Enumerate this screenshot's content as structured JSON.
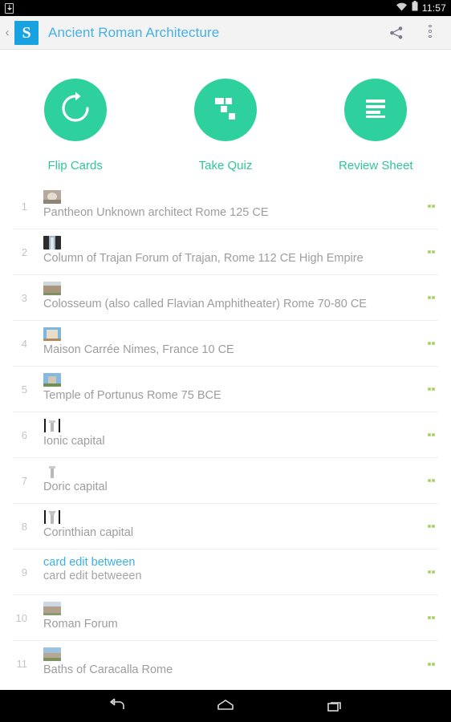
{
  "status_bar": {
    "download_icon": "download-icon",
    "wifi_icon": "wifi-icon",
    "battery_icon": "battery-icon",
    "time": "11:57"
  },
  "action_bar": {
    "back_label": "‹",
    "logo_text": "S",
    "logo_color": "#18a2e0",
    "title": "Ancient Roman Architecture",
    "title_color": "#46b0e6",
    "share_icon": "share-icon",
    "overflow_icon": "overflow-menu-icon"
  },
  "actions": {
    "accent_color": "#2ed09e",
    "items": [
      {
        "label": "Flip Cards",
        "icon": "refresh-rotate-icon"
      },
      {
        "label": "Take Quiz",
        "icon": "quiz-blocks-icon"
      },
      {
        "label": "Review Sheet",
        "icon": "list-lines-icon"
      }
    ]
  },
  "card_list": {
    "rows": [
      {
        "num": "1",
        "thumb": "pantheon-thumb",
        "text": "Pantheon  Unknown architect  Rome  125 CE",
        "badge": "study-progress-badge"
      },
      {
        "num": "2",
        "thumb": "column-trajan-thumb",
        "text": "Column of Trajan  Forum of Trajan, Rome  112 CE  High Empire",
        "badge": "study-progress-badge"
      },
      {
        "num": "3",
        "thumb": "colosseum-thumb",
        "text": "Colosseum (also called Flavian Amphitheater)  Rome  70-80 CE",
        "badge": "study-progress-badge"
      },
      {
        "num": "4",
        "thumb": "maison-carree-thumb",
        "text": "Maison Carrée  Nimes, France  10 CE",
        "badge": "study-progress-badge"
      },
      {
        "num": "5",
        "thumb": "temple-portunus-thumb",
        "text": "Temple of Portunus  Rome  75 BCE",
        "badge": "study-progress-badge"
      },
      {
        "num": "6",
        "thumb": "ionic-capital-thumb",
        "text": "Ionic capital",
        "badge": "study-progress-badge"
      },
      {
        "num": "7",
        "thumb": "doric-capital-thumb",
        "text": "Doric capital",
        "badge": "study-progress-badge"
      },
      {
        "num": "8",
        "thumb": "corinthian-capital-thumb",
        "text": "Corinthian capital",
        "badge": "study-progress-badge"
      },
      {
        "num": "9",
        "thumb": null,
        "question": "card edit between",
        "answer": "card edit betweeen",
        "badge": "study-progress-badge"
      },
      {
        "num": "10",
        "thumb": "roman-forum-thumb",
        "text": "Roman Forum",
        "badge": "study-progress-badge"
      },
      {
        "num": "11",
        "thumb": "baths-caracalla-thumb",
        "text": "Baths of Caracalla  Rome",
        "badge": "study-progress-badge"
      }
    ]
  },
  "nav_bar": {
    "back_icon": "android-back-icon",
    "home_icon": "android-home-icon",
    "recents_icon": "android-recents-icon"
  }
}
